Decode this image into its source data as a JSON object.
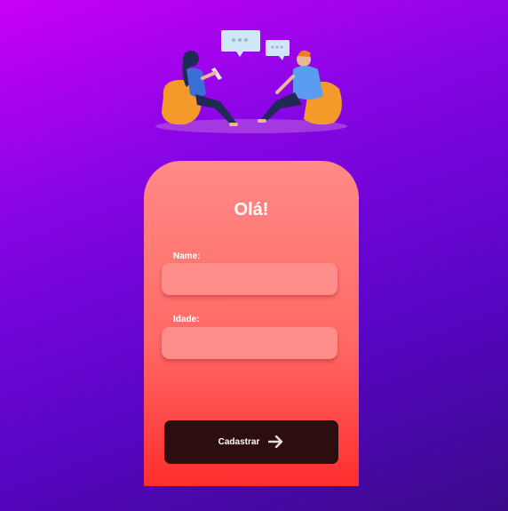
{
  "card": {
    "greeting": "Olá!",
    "name_label": "Name:",
    "age_label": "Idade:",
    "name_value": "",
    "age_value": "",
    "submit_label": "Cadastrar",
    "submit_icon": "arrow-right-icon"
  },
  "illustration": {
    "subject": "two-people-chatting-illustration"
  },
  "colors": {
    "background_start": "#c800f8",
    "background_end": "#3a0a8a",
    "card_top": "#ff8a86",
    "card_bottom": "#ff2e2e",
    "field_fill": "#ff8e8a",
    "button_fill": "#2c0e0e"
  }
}
